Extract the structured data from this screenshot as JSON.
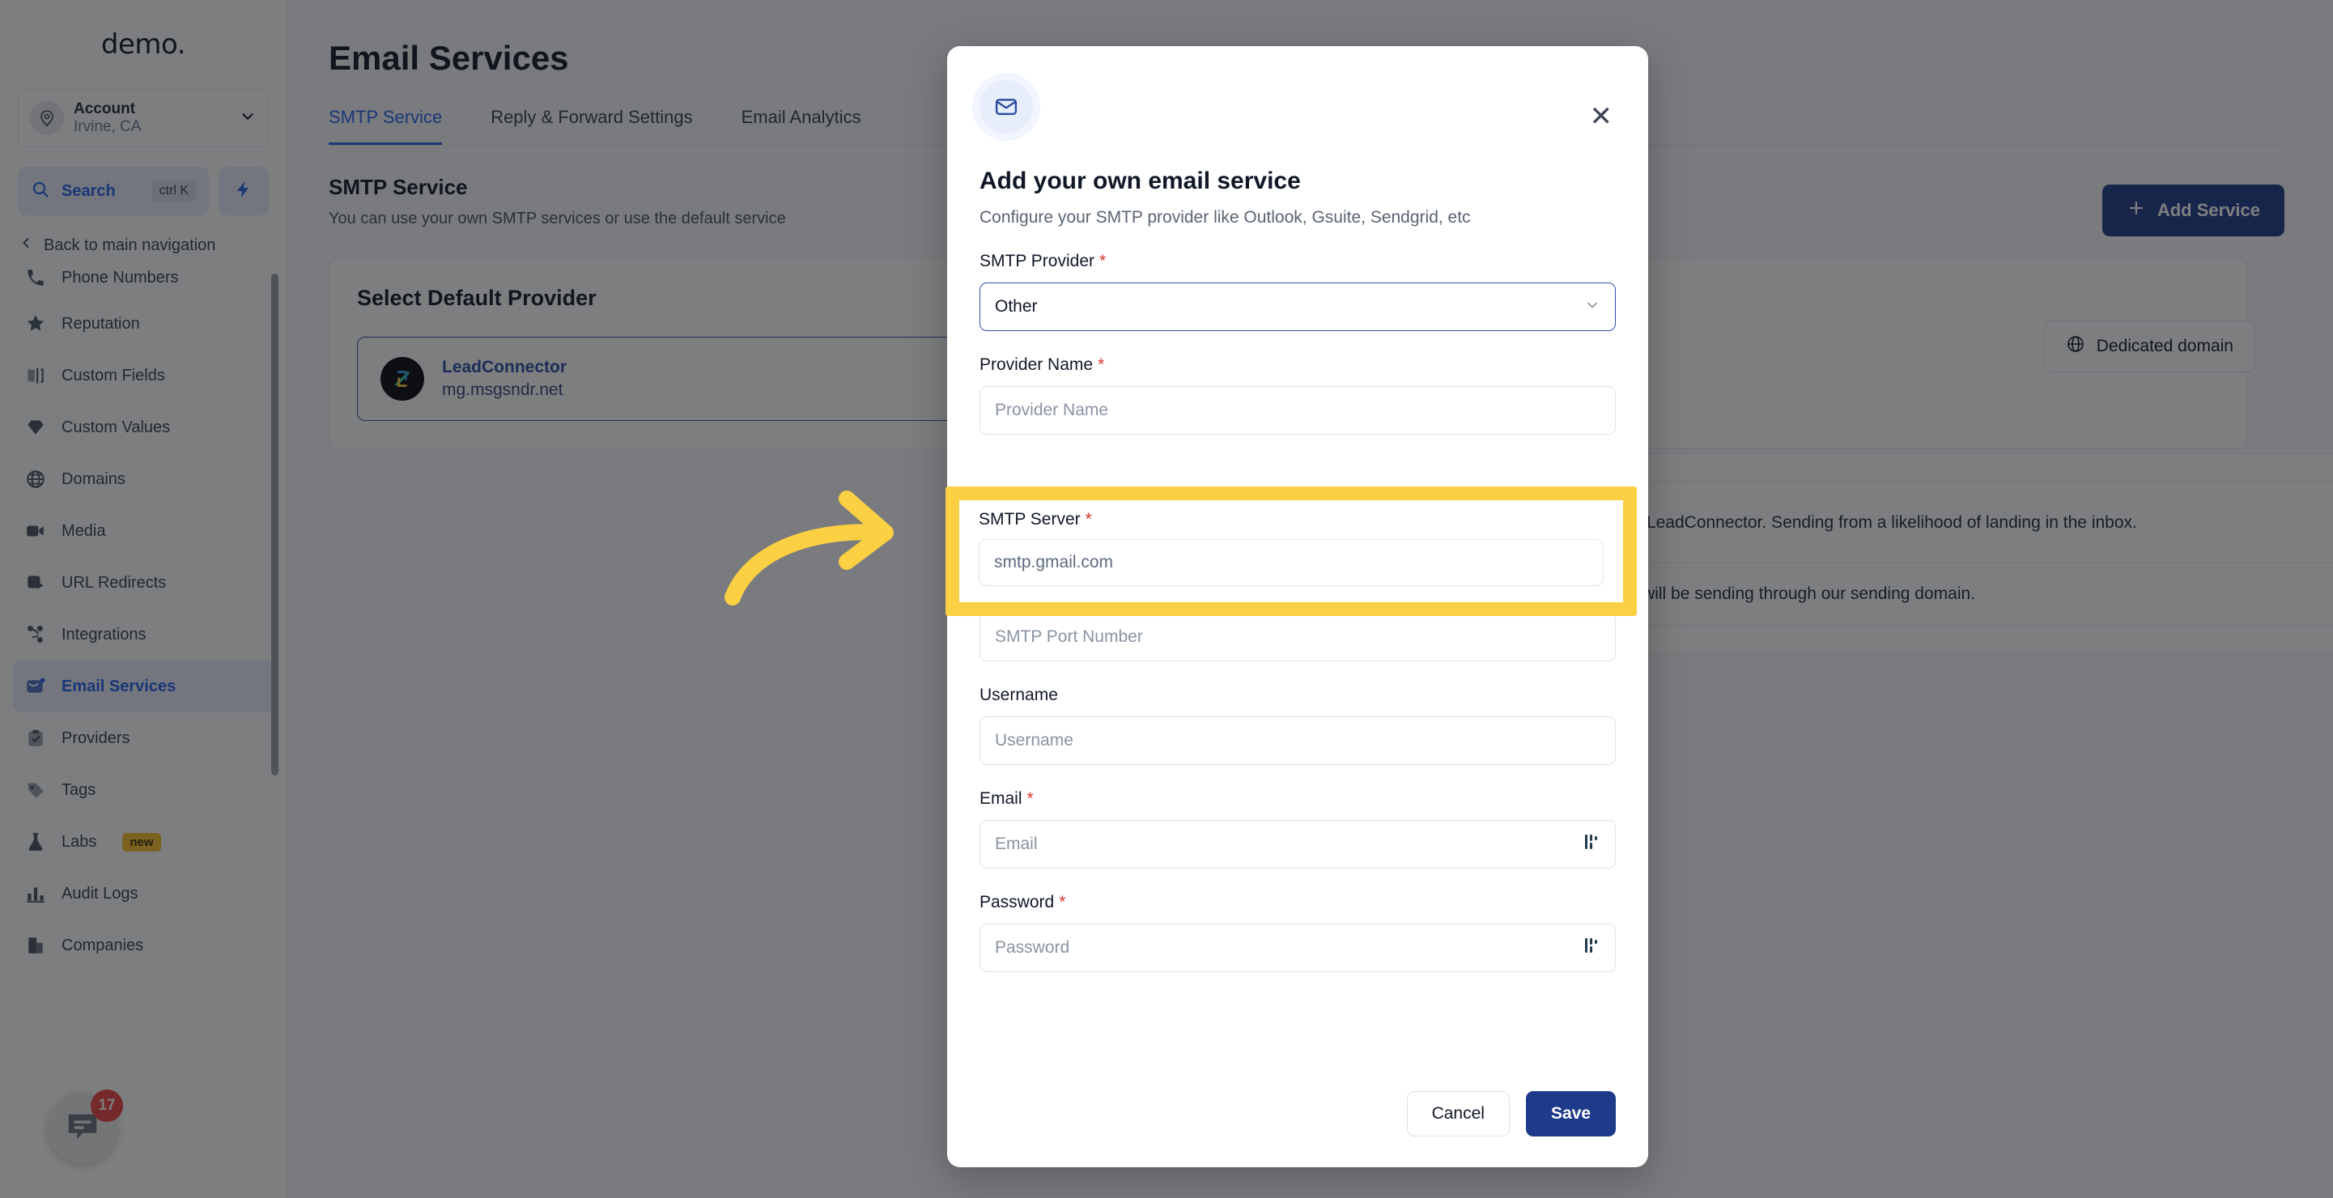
{
  "sidebar": {
    "brand": "demo.",
    "account": {
      "name": "Account",
      "location": "Irvine, CA",
      "avatar_icon": "location-pin-icon",
      "chevron_icon": "chevron-down-icon"
    },
    "search": {
      "label": "Search",
      "shortcut": "ctrl K",
      "icon": "search-icon",
      "bolt_icon": "bolt-icon"
    },
    "back_nav": {
      "label": "Back to main navigation",
      "icon": "chevron-left-icon"
    },
    "items": [
      {
        "label": "Phone Numbers",
        "icon": "phone-icon",
        "active": false
      },
      {
        "label": "Reputation",
        "icon": "star-icon",
        "active": false
      },
      {
        "label": "Custom Fields",
        "icon": "custom-fields-icon",
        "active": false
      },
      {
        "label": "Custom Values",
        "icon": "diamond-icon",
        "active": false
      },
      {
        "label": "Domains",
        "icon": "globe-icon",
        "active": false
      },
      {
        "label": "Media",
        "icon": "media-icon",
        "active": false
      },
      {
        "label": "URL Redirects",
        "icon": "redirect-icon",
        "active": false
      },
      {
        "label": "Integrations",
        "icon": "integrations-icon",
        "active": false
      },
      {
        "label": "Email Services",
        "icon": "email-icon",
        "active": true
      },
      {
        "label": "Providers",
        "icon": "clipboard-check-icon",
        "active": false
      },
      {
        "label": "Tags",
        "icon": "tag-icon",
        "active": false
      },
      {
        "label": "Labs",
        "icon": "flask-icon",
        "active": false,
        "badge": "new"
      },
      {
        "label": "Audit Logs",
        "icon": "bar-chart-icon",
        "active": false
      },
      {
        "label": "Companies",
        "icon": "building-icon",
        "active": false
      }
    ],
    "chat_widget": {
      "count": "17",
      "icon": "chat-bubble-icon"
    }
  },
  "main": {
    "page_title": "Email Services",
    "tabs": [
      {
        "label": "SMTP Service",
        "active": true
      },
      {
        "label": "Reply & Forward Settings",
        "active": false
      },
      {
        "label": "Email Analytics",
        "active": false
      }
    ],
    "section_title": "SMTP Service",
    "section_sub": "You can use your own SMTP services or use the default service",
    "add_service_button": {
      "label": "Add Service",
      "icon": "plus-icon"
    },
    "default_provider_card": {
      "heading": "Select Default Provider",
      "provider": {
        "name": "LeadConnector",
        "domain": "mg.msgsndr.net",
        "logo_icon": "leadconnector-logo-icon"
      }
    },
    "dedicated_domain_button": {
      "label": "Dedicated domain",
      "icon": "globe-icon"
    },
    "right_card": {
      "body": "domain to use on LeadConnector. Sending from a likelihood of landing in the inbox.",
      "note": "p now, emails will be sending through our sending domain."
    }
  },
  "modal": {
    "icon": "mail-icon",
    "close_icon": "close-icon",
    "title": "Add your own email service",
    "subtitle": "Configure your SMTP provider like Outlook, Gsuite, Sendgrid, etc",
    "fields": [
      {
        "label": "SMTP Provider",
        "required": true,
        "type": "select",
        "value": "Other",
        "placeholder": "",
        "caret_icon": "chevron-down-icon"
      },
      {
        "label": "Provider Name",
        "required": true,
        "type": "text",
        "value": "",
        "placeholder": "Provider Name"
      },
      {
        "label": "SMTP Port Number",
        "required": true,
        "type": "text",
        "value": "",
        "placeholder": "SMTP Port Number"
      },
      {
        "label": "Username",
        "required": false,
        "type": "text",
        "value": "",
        "placeholder": "Username"
      },
      {
        "label": "Email",
        "required": true,
        "type": "text",
        "value": "",
        "placeholder": "Email",
        "trailing_icon": "merge-field-icon"
      },
      {
        "label": "Password",
        "required": true,
        "type": "text",
        "value": "",
        "placeholder": "Password",
        "trailing_icon": "merge-field-icon"
      }
    ],
    "cancel_button": "Cancel",
    "save_button": "Save"
  },
  "annotation": {
    "highlight_color": "#fcd043",
    "arrow_color": "#fcd043",
    "arrow_icon": "curved-arrow-right-icon",
    "highlighted_field": {
      "label": "SMTP Server",
      "required": true,
      "placeholder": "smtp.gmail.com",
      "value": ""
    }
  }
}
